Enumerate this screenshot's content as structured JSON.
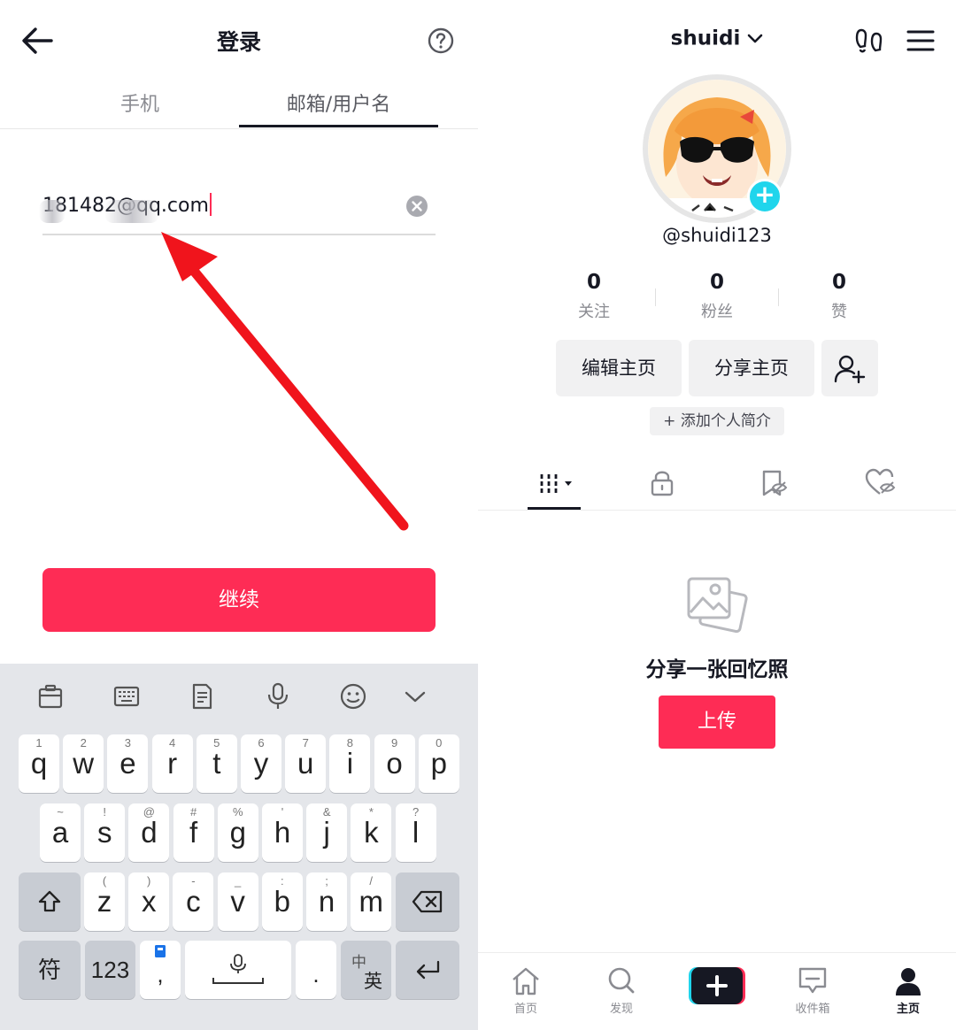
{
  "login": {
    "title": "登录",
    "tabs": [
      "手机",
      "邮箱/用户名"
    ],
    "email_visible_prefix": "181482",
    "email_suffix": "@qq.com",
    "continue_label": "继续"
  },
  "keyboard": {
    "row1": [
      {
        "k": "q",
        "s": "1"
      },
      {
        "k": "w",
        "s": "2"
      },
      {
        "k": "e",
        "s": "3"
      },
      {
        "k": "r",
        "s": "4"
      },
      {
        "k": "t",
        "s": "5"
      },
      {
        "k": "y",
        "s": "6"
      },
      {
        "k": "u",
        "s": "7"
      },
      {
        "k": "i",
        "s": "8"
      },
      {
        "k": "o",
        "s": "9"
      },
      {
        "k": "p",
        "s": "0"
      }
    ],
    "row2": [
      {
        "k": "a",
        "s": "~"
      },
      {
        "k": "s",
        "s": "!"
      },
      {
        "k": "d",
        "s": "@"
      },
      {
        "k": "f",
        "s": "#"
      },
      {
        "k": "g",
        "s": "%"
      },
      {
        "k": "h",
        "s": "'"
      },
      {
        "k": "j",
        "s": "&"
      },
      {
        "k": "k",
        "s": "*"
      },
      {
        "k": "l",
        "s": "?"
      }
    ],
    "row3": [
      {
        "k": "z",
        "s": "("
      },
      {
        "k": "x",
        "s": ")"
      },
      {
        "k": "c",
        "s": "-"
      },
      {
        "k": "v",
        "s": "_"
      },
      {
        "k": "b",
        "s": ":"
      },
      {
        "k": "n",
        "s": ";"
      },
      {
        "k": "m",
        "s": "/"
      }
    ],
    "symbol_key": "符",
    "number_key": "123",
    "comma_key": ",",
    "period_key": ".",
    "lang_key_top": "中",
    "lang_key_bottom": "英"
  },
  "profile": {
    "username": "shuidi",
    "handle": "@shuidi123",
    "stats": [
      {
        "num": "0",
        "label": "关注"
      },
      {
        "num": "0",
        "label": "粉丝"
      },
      {
        "num": "0",
        "label": "赞"
      }
    ],
    "edit_label": "编辑主页",
    "share_label": "分享主页",
    "bio_label": "+ 添加个人简介",
    "empty_text": "分享一张回忆照",
    "upload_label": "上传"
  },
  "bottom_nav": [
    "首页",
    "发现",
    "收件箱",
    "主页"
  ],
  "colors": {
    "accent": "#fe2c55",
    "cyan": "#20d5ec",
    "text": "#161823",
    "muted": "#8a8b91",
    "annotation_arrow": "#f0141c"
  }
}
